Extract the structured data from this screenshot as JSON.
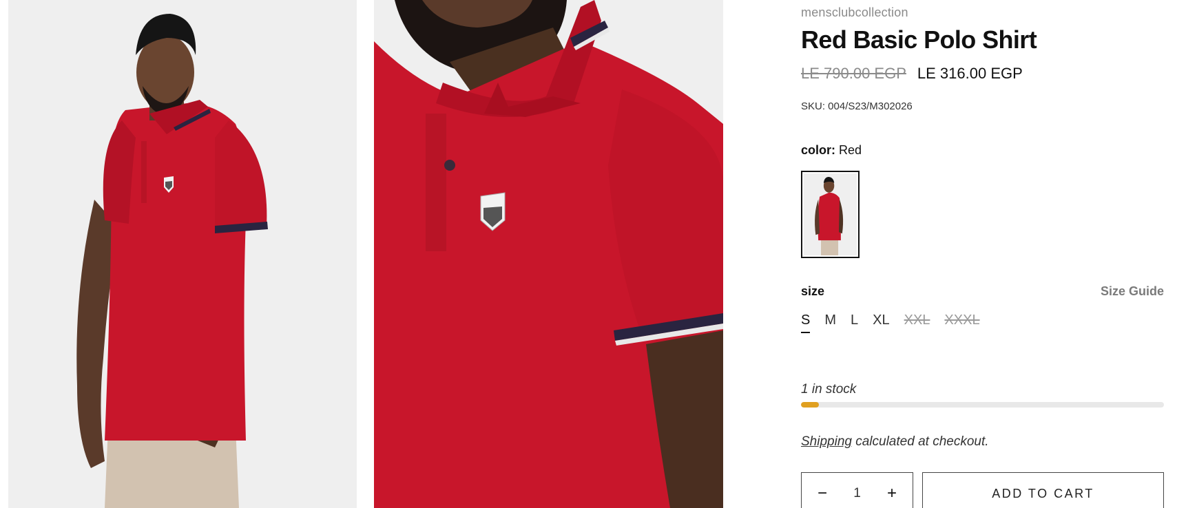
{
  "product": {
    "vendor": "mensclubcollection",
    "title": "Red Basic Polo Shirt",
    "price_compare": "LE 790.00 EGP",
    "price_sale": "LE 316.00 EGP",
    "sku": "SKU: 004/S23/M302026"
  },
  "images": [
    {
      "alt": "model wearing red polo shirt, full view",
      "icon": "product-photo"
    },
    {
      "alt": "close-up of red polo shirt collar and logo",
      "icon": "product-photo"
    }
  ],
  "color": {
    "label": "color:",
    "value": "Red",
    "swatch_color": "#c8162b"
  },
  "size": {
    "label": "size",
    "guide_label": "Size Guide",
    "options": [
      {
        "label": "S",
        "state": "selected"
      },
      {
        "label": "M",
        "state": "available"
      },
      {
        "label": "L",
        "state": "available"
      },
      {
        "label": "XL",
        "state": "available"
      },
      {
        "label": "XXL",
        "state": "sold-out"
      },
      {
        "label": "XXXL",
        "state": "sold-out"
      }
    ]
  },
  "stock": {
    "text": "1 in stock",
    "level": 0.05,
    "bar_color": "#e0a020"
  },
  "shipping": {
    "link": "Shipping",
    "text": " calculated at checkout."
  },
  "cart": {
    "decrement": "−",
    "quantity": "1",
    "increment": "+",
    "add_label": "ADD TO CART"
  },
  "colors": {
    "shirt": "#c8162b",
    "background": "#efefef",
    "accent": "#e0a020"
  }
}
